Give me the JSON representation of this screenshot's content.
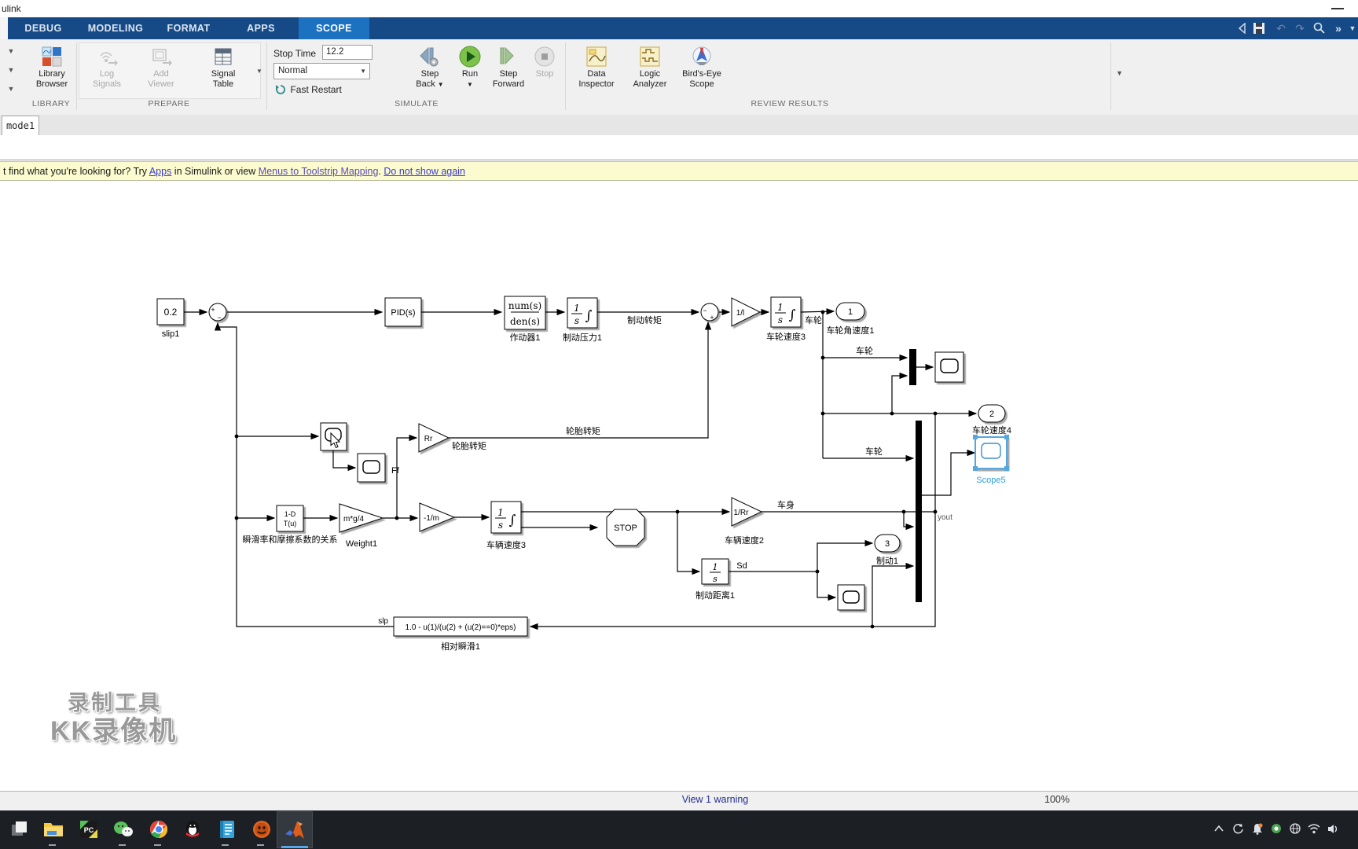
{
  "window": {
    "title": "ulink"
  },
  "ribbon": {
    "tabs": [
      "DEBUG",
      "MODELING",
      "FORMAT",
      "APPS",
      "SCOPE"
    ],
    "active_tab": "SCOPE",
    "groups": {
      "library": {
        "label": "LIBRARY",
        "browser1": "Library",
        "browser2": "Browser"
      },
      "prepare": {
        "label": "PREPARE",
        "log1": "Log",
        "log2": "Signals",
        "add1": "Add",
        "add2": "Viewer",
        "table1": "Signal",
        "table2": "Table"
      },
      "simulate": {
        "label": "SIMULATE",
        "stop_time_label": "Stop Time",
        "stop_time_value": "12.2",
        "mode_value": "Normal",
        "fast_restart": "Fast Restart",
        "step_back1": "Step",
        "step_back2": "Back",
        "run": "Run",
        "step_fwd1": "Step",
        "step_fwd2": "Forward",
        "stop": "Stop"
      },
      "review": {
        "label": "REVIEW RESULTS",
        "di1": "Data",
        "di2": "Inspector",
        "la1": "Logic",
        "la2": "Analyzer",
        "be1": "Bird's-Eye",
        "be2": "Scope"
      }
    }
  },
  "document_tab": "mode1",
  "notification": {
    "prefix": "t find what you're looking for? Try ",
    "apps_link": "Apps",
    "middle": " in Simulink or view ",
    "mapping_link": "Menus to Toolstrip Mapping",
    "period": ". ",
    "dismiss_link": "Do not show again"
  },
  "diagram": {
    "glyph": {
      "one": "1",
      "s": "s",
      "integral": "∫"
    },
    "blocks": {
      "slip_constant": {
        "value": "0.2",
        "label": "slip1"
      },
      "pid": "PID(s)",
      "actuator": {
        "num": "num(s)",
        "den": "den(s)",
        "label": "作动器1"
      },
      "brake_pressure_label": "制动压力1",
      "gain_1_I": "1/l",
      "wheel_speed3_label": "车轮速度3",
      "lookup": {
        "line1": "1-D",
        "line2": "T(u)",
        "label": "瞬滑率和摩擦系数的关系"
      },
      "weight_gain": {
        "text": "m*g/4",
        "label": "Weight1"
      },
      "inv_mass_gain": "-1/m",
      "vehicle_speed3_label": "车辆速度3",
      "stop": "STOP",
      "tire_gain": {
        "text": "Rr",
        "label": "轮胎转矩"
      },
      "ff_label": "Ff",
      "gain_1_Rr": {
        "text": "1/Rr",
        "label": "车辆速度2"
      },
      "brake_distance_label": "制动距离1",
      "fcn": {
        "text": "1.0 - u(1)/(u(2) + (u(2)==0)*eps)",
        "label": "相对瞬滑1"
      },
      "scope5_label": "Scope5",
      "yout": "yout"
    },
    "signals": {
      "brake_torque": "制动转矩",
      "wheel": "车轮",
      "tire_torque": "轮胎转矩",
      "body": "车身",
      "sd": "Sd",
      "slp": "slp"
    },
    "ports": {
      "p1": {
        "num": "1",
        "label": "车轮角速度1"
      },
      "p2": {
        "num": "2",
        "label": "车轮速度4"
      },
      "p3": {
        "num": "3",
        "label": "制动1"
      }
    }
  },
  "watermark": {
    "line1": "录制工具",
    "line2": "KK录像机"
  },
  "status_bar": {
    "warning": "View 1 warning",
    "zoom": "100%"
  },
  "taskbar": {
    "icons": [
      "task-view-icon",
      "file-explorer-icon",
      "pycharm-icon",
      "wechat-icon",
      "chrome-icon",
      "qq-icon",
      "notepad-icon",
      "kk-recorder-icon",
      "matlab-icon"
    ],
    "tray_icons": [
      "tray-expand-icon",
      "sync-icon",
      "bell-icon",
      "status-dot-icon",
      "globe-icon",
      "wifi-icon",
      "volume-icon"
    ]
  },
  "colors": {
    "ribbon_band": "#164a86",
    "active_tab": "#1d71c1",
    "run_green": "#5ea33a",
    "selection_blue": "#55a7dd",
    "notification_bg": "#fbfbcf",
    "link_blue": "#3b3bd6",
    "taskbar_bg": "#1c1f24",
    "matlab_orange": "#e05c1a"
  }
}
